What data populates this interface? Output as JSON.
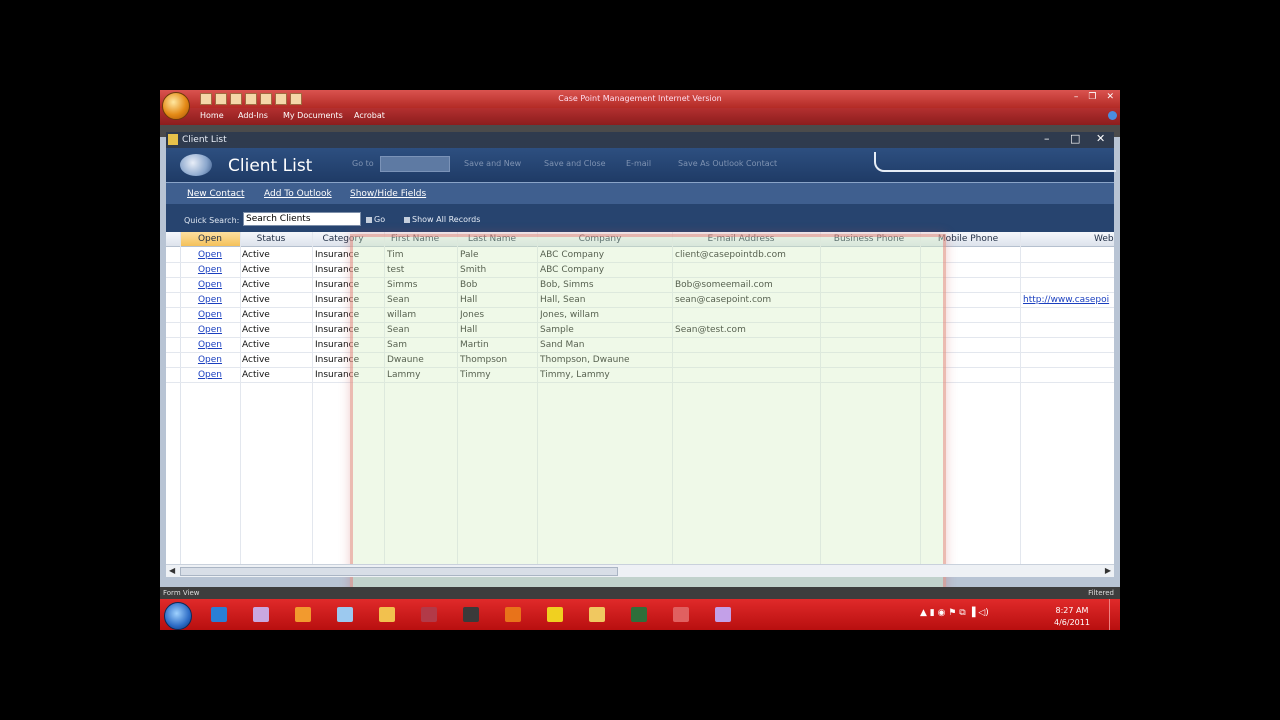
{
  "window": {
    "title": "Case Point Management Internet Version",
    "ribbon_tabs": [
      "Home",
      "Add-Ins",
      "My Documents",
      "Acrobat"
    ],
    "minimize": "–",
    "restore": "❐",
    "close": "✕"
  },
  "document": {
    "tab_title": "Client List",
    "min": "–",
    "max": "□",
    "close": "✕"
  },
  "header": {
    "title": "Client List",
    "ghost_goto": "Go to",
    "ghost_save_new": "Save and New",
    "ghost_save_close": "Save and Close",
    "ghost_email": "E-mail",
    "ghost_outlook": "Save As Outlook Contact"
  },
  "toolbar": {
    "new_contact": "New Contact",
    "add_to_outlook": "Add To Outlook",
    "show_hide_fields": "Show/Hide Fields"
  },
  "search": {
    "label": "Quick Search:",
    "value": "Search Clients",
    "go": "Go",
    "show_all": "Show All Records"
  },
  "grid": {
    "columns": [
      "Open",
      "Status",
      "Category",
      "First Name",
      "Last Name",
      "Company",
      "E-mail Address",
      "Business Phone",
      "Mobile Phone",
      "Web"
    ],
    "rows": [
      {
        "open": "Open",
        "status": "Active",
        "category": "Insurance",
        "first": "Tim",
        "last": "Pale",
        "company": "ABC Company",
        "email": "client@casepointdb.com",
        "web": ""
      },
      {
        "open": "Open",
        "status": "Active",
        "category": "Insurance",
        "first": "test",
        "last": "Smith",
        "company": "ABC Company",
        "email": "",
        "web": ""
      },
      {
        "open": "Open",
        "status": "Active",
        "category": "Insurance",
        "first": "Simms",
        "last": "Bob",
        "company": "Bob, Simms",
        "email": "Bob@someemail.com",
        "web": ""
      },
      {
        "open": "Open",
        "status": "Active",
        "category": "Insurance",
        "first": "Sean",
        "last": "Hall",
        "company": "Hall, Sean",
        "email": "sean@casepoint.com",
        "web": "http://www.casepoi"
      },
      {
        "open": "Open",
        "status": "Active",
        "category": "Insurance",
        "first": "willam",
        "last": "Jones",
        "company": "Jones, willam",
        "email": "",
        "web": ""
      },
      {
        "open": "Open",
        "status": "Active",
        "category": "Insurance",
        "first": "Sean",
        "last": "Hall",
        "company": "Sample",
        "email": "Sean@test.com",
        "web": ""
      },
      {
        "open": "Open",
        "status": "Active",
        "category": "Insurance",
        "first": "Sam",
        "last": "Martin",
        "company": "Sand Man",
        "email": "",
        "web": ""
      },
      {
        "open": "Open",
        "status": "Active",
        "category": "Insurance",
        "first": "Dwaune",
        "last": "Thompson",
        "company": "Thompson, Dwaune",
        "email": "",
        "web": ""
      },
      {
        "open": "Open",
        "status": "Active",
        "category": "Insurance",
        "first": "Lammy",
        "last": "Timmy",
        "company": "Timmy, Lammy",
        "email": "",
        "web": ""
      }
    ]
  },
  "scroll": {
    "left": "◀",
    "right": "▶"
  },
  "statusbar": {
    "left": "Form View",
    "right": "Filtered"
  },
  "taskbar": {
    "apps": [
      {
        "icon": "internet-explorer-icon",
        "color": "#2a7fd6"
      },
      {
        "icon": "documents-icon",
        "color": "#c9a8e0"
      },
      {
        "icon": "media-player-icon",
        "color": "#f29a2e"
      },
      {
        "icon": "notepad-icon",
        "color": "#9cc9ef"
      },
      {
        "icon": "folder-icon",
        "color": "#f2c14e"
      },
      {
        "icon": "access-icon",
        "color": "#b23a48"
      },
      {
        "icon": "network-icon",
        "color": "#3a3a3a"
      },
      {
        "icon": "firefox-icon",
        "color": "#e8731a"
      },
      {
        "icon": "arrow-app-icon",
        "color": "#f0d020"
      },
      {
        "icon": "explorer-icon",
        "color": "#f0c860"
      },
      {
        "icon": "terminal-icon",
        "color": "#2f6f3a"
      },
      {
        "icon": "key-icon",
        "color": "#e06060"
      },
      {
        "icon": "image-icon",
        "color": "#c3a0e8"
      }
    ],
    "tray": "▲ ▮ ◉ ⚑ ⧉ ▐ ◁)",
    "time": "8:27 AM",
    "date": "4/6/2011"
  }
}
